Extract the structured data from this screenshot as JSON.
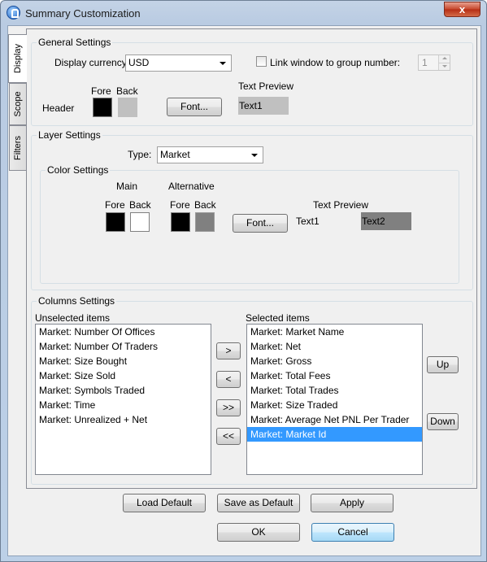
{
  "window": {
    "title": "Summary Customization",
    "close_glyph": "x"
  },
  "tabs": [
    {
      "label": "Display",
      "active": true
    },
    {
      "label": "Scope",
      "active": false
    },
    {
      "label": "Filters",
      "active": false
    }
  ],
  "general": {
    "group_label": "General Settings",
    "currency_label": "Display currency:",
    "currency_value": "USD",
    "link_label": "Link window to group number:",
    "link_checked": false,
    "group_number": "1",
    "fore_label": "Fore",
    "back_label": "Back",
    "header_label": "Header",
    "font_button": "Font...",
    "text_preview_label": "Text Preview",
    "preview_text": "Text1",
    "colors": {
      "fore": "#000000",
      "back": "#c0c0c0",
      "preview_bg": "#c0c0c0"
    }
  },
  "layer": {
    "group_label": "Layer Settings",
    "type_label": "Type:",
    "type_value": "Market",
    "color_settings_label": "Color Settings",
    "main_label": "Main",
    "alternative_label": "Alternative",
    "fore_label": "Fore",
    "back_label": "Back",
    "font_button": "Font...",
    "text_preview_label": "Text Preview",
    "preview_text1": "Text1",
    "preview_text2": "Text2",
    "colors": {
      "main_fore": "#000000",
      "main_back": "#ffffff",
      "alt_fore": "#000000",
      "alt_back": "#808080",
      "preview2_bg": "#808080"
    }
  },
  "columns": {
    "group_label": "Columns Settings",
    "unselected_label": "Unselected items",
    "selected_label": "Selected items",
    "unselected": [
      "Market: Number Of Offices",
      "Market: Number Of Traders",
      "Market: Size Bought",
      "Market: Size Sold",
      "Market: Symbols Traded",
      "Market: Time",
      "Market: Unrealized + Net"
    ],
    "selected": [
      "Market: Market Name",
      "Market: Net",
      "Market: Gross",
      "Market: Total Fees",
      "Market: Total Trades",
      "Market: Size Traded",
      "Market: Average Net PNL Per Trader",
      "Market: Market Id"
    ],
    "selected_highlight_index": 7,
    "move_buttons": {
      "add": ">",
      "remove": "<",
      "add_all": ">>",
      "remove_all": "<<"
    },
    "up_button": "Up",
    "down_button": "Down"
  },
  "footer": {
    "load_default": "Load Default",
    "save_default": "Save as Default",
    "apply": "Apply",
    "ok": "OK",
    "cancel": "Cancel"
  }
}
